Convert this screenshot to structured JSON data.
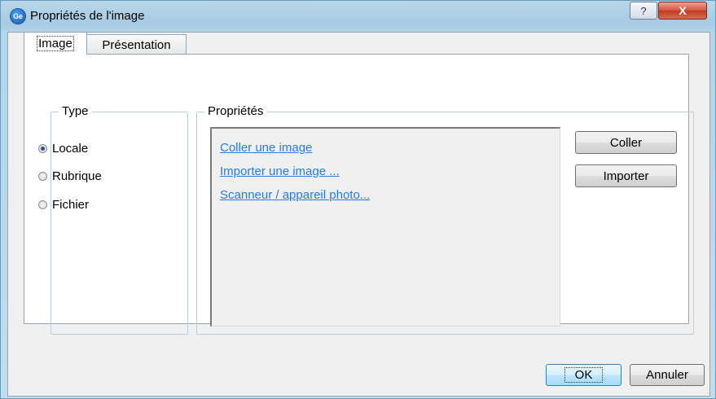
{
  "window": {
    "title": "Propriétés de l'image",
    "icon_text": "Ge",
    "help_glyph": "?",
    "close_glyph": "X"
  },
  "tabs": [
    {
      "label": "Image",
      "active": true
    },
    {
      "label": "Présentation",
      "active": false
    }
  ],
  "type_group": {
    "legend": "Type",
    "options": [
      {
        "label": "Locale",
        "checked": true
      },
      {
        "label": "Rubrique",
        "checked": false
      },
      {
        "label": "Fichier",
        "checked": false
      }
    ]
  },
  "props_group": {
    "legend": "Propriétés",
    "links": [
      "Coller une image",
      "Importer  une image ...",
      "Scanneur / appareil photo..."
    ],
    "buttons": {
      "paste": "Coller",
      "import": "Importer"
    }
  },
  "footer": {
    "ok": "OK",
    "cancel": "Annuler"
  },
  "colors": {
    "link": "#2a7ae2",
    "close_button": "#c23a22",
    "title_bar": "#a6cbe3"
  }
}
